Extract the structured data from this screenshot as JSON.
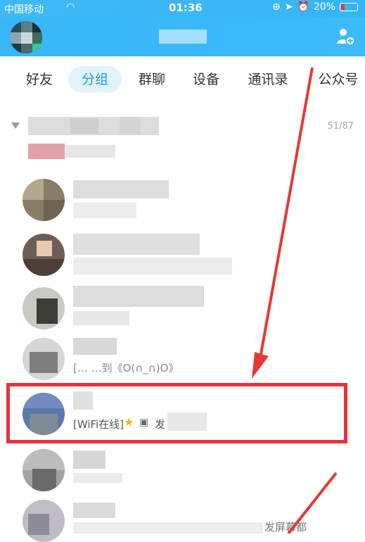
{
  "status": {
    "carrier": "中国移动",
    "time": "01:36",
    "battery": "20%"
  },
  "tabs": [
    {
      "label": "好友"
    },
    {
      "label": "分组"
    },
    {
      "label": "群聊"
    },
    {
      "label": "设备"
    },
    {
      "label": "通讯录"
    },
    {
      "label": "公众号"
    }
  ],
  "group": {
    "count": "51/87"
  },
  "rows": {
    "r4_snippet": "[…  …到《O(∩_∩)O》",
    "r5_snippet": "[WiFi在线]",
    "r5_tail": "发",
    "r7_snippet": "发屏幕都"
  },
  "colors": {
    "header": "#37b7f7",
    "accent": "#1aa3e8",
    "highlight": "#e8323a"
  }
}
